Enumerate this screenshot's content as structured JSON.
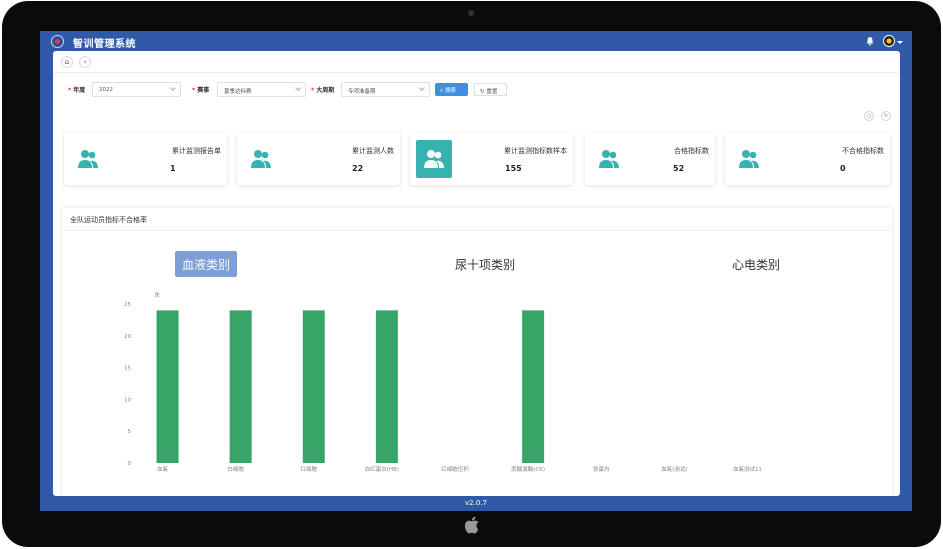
{
  "app": {
    "title": "智训管理系统",
    "version": "v2.0.7"
  },
  "tabs": {
    "home_icon": "home-icon",
    "back_icon": "chevron-left-icon"
  },
  "filters": {
    "year_label": "年度",
    "year_value": "2022",
    "event_label": "赛事",
    "event_value": "夏季达标赛",
    "period_label": "大周期",
    "period_value": "专项准备期",
    "search_label": "搜索",
    "reset_label": "重置"
  },
  "cards": [
    {
      "title": "累计监测报告单",
      "value": "1"
    },
    {
      "title": "累计监测人数",
      "value": "22"
    },
    {
      "title": "累计监测指标数样本",
      "value": "155"
    },
    {
      "title": "合格指标数",
      "value": "52"
    },
    {
      "title": "不合格指标数",
      "value": "0"
    }
  ],
  "panel": {
    "title": "全队运动员指标不合格率",
    "categories": [
      {
        "label": "血液类别",
        "active": true
      },
      {
        "label": "尿十项类别",
        "active": false
      },
      {
        "label": "心电类别",
        "active": false
      }
    ]
  },
  "colors": {
    "brand": "#2f5aa8",
    "card_icon": "#36b3b0",
    "bar": "#38a467",
    "primary_button": "#3d8fe0",
    "active_category": "#7e9ed6"
  },
  "chart_data": {
    "type": "bar",
    "ylabel": "次",
    "ylim": [
      0,
      25
    ],
    "yticks": [
      0,
      5,
      10,
      15,
      20,
      25
    ],
    "categories": [
      "血氧",
      "白细胞",
      "红细胞",
      "血红蛋白(HB)",
      "红细胞压积",
      "肌酸激酶(CK)",
      "铁蛋白",
      "血氧(测试)",
      "血氧测试11"
    ],
    "values": [
      24,
      24,
      24,
      24,
      0,
      24,
      0,
      0,
      0
    ],
    "grid": false
  }
}
